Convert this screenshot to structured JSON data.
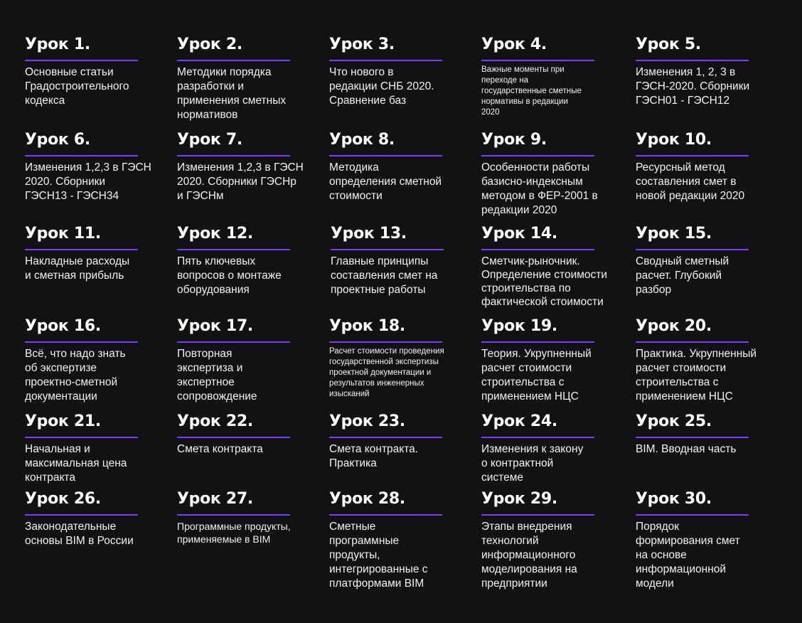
{
  "accent_color": "#7b3ff2",
  "background_color": "#121114",
  "lessons": [
    {
      "title": "Урок 1.",
      "text": "Основные статьи\nГрадостроительного\nкодекса"
    },
    {
      "title": "Урок 2.",
      "text": "Методики порядка\nразработки и\nприменения сметных\nнормативов"
    },
    {
      "title": "Урок 3.",
      "text": "Что нового в\nредакции СНБ 2020.\nСравнение баз"
    },
    {
      "title": "Урок 4.",
      "text": "Важные моменты при\nпереходе на\nгосударственные сметные\nнормативы в редакции\n2020"
    },
    {
      "title": "Урок 5.",
      "text": "Изменения 1, 2, 3 в\nГЭСН-2020. Сборники\nГЭСН01 - ГЭСН12"
    },
    {
      "title": "Урок 6.",
      "text": "Изменения 1,2,3 в ГЭСН\n2020. Сборники\nГЭСН13 - ГЭСН34"
    },
    {
      "title": "Урок 7.",
      "text": "Изменения 1,2,3 в ГЭСН\n2020. Сборники ГЭСНр\nи ГЭСНм"
    },
    {
      "title": "Урок 8.",
      "text": "Методика\nопределения сметной\nстоимости"
    },
    {
      "title": "Урок 9.",
      "text": "Особенности работы\nбазисно-индексным\nметодом в ФЕР-2001 в\nредакции 2020"
    },
    {
      "title": "Урок 10.",
      "text": "Ресурсный метод\nсоставления смет в\nновой редакции 2020"
    },
    {
      "title": "Урок 11.",
      "text": "Накладные расходы\nи сметная прибыль"
    },
    {
      "title": "Урок 12.",
      "text": "Пять ключевых\nвопросов о монтаже\nоборудования"
    },
    {
      "title": "Урок 13.",
      "text": "Главные принципы\nсоставления смет на\nпроектные работы"
    },
    {
      "title": "Урок 14.",
      "text": "Сметчик-рыночник.\nОпределение стоимости\nстроительства по\nфактической стоимости"
    },
    {
      "title": "Урок 15.",
      "text": "Сводный сметный\nрасчет. Глубокий\nразбор"
    },
    {
      "title": "Урок 16.",
      "text": "Всё, что надо знать\nоб экспертизе\nпроектно-сметной\nдокументации"
    },
    {
      "title": "Урок 17.",
      "text": "Повторная\nэкспертиза и\nэкспертное\nсопровождение"
    },
    {
      "title": "Урок 18.",
      "text": "Расчет стоимости проведения\nгосударственной экспертизы\nпроектной документации и\nрезультатов инженерных\nизысканий"
    },
    {
      "title": "Урок 19.",
      "text": "Теория. Укрупненный\nрасчет стоимости\nстроительства с\nприменением НЦС"
    },
    {
      "title": "Урок 20.",
      "text": "Практика. Укрупненный\nрасчет стоимости\nстроительства с\nприменением НЦС"
    },
    {
      "title": "Урок 21.",
      "text": "Начальная и\nмаксимальная цена\nконтракта"
    },
    {
      "title": "Урок 22.",
      "text": "Смета контракта"
    },
    {
      "title": "Урок 23.",
      "text": "Смета контракта.\nПрактика"
    },
    {
      "title": "Урок 24.",
      "text": "Изменения к закону\nо контрактной\nсистеме"
    },
    {
      "title": "Урок 25.",
      "text": "BIM. Вводная часть"
    },
    {
      "title": "Урок 26.",
      "text": "Законодательные\nосновы BIM в России"
    },
    {
      "title": "Урок 27.",
      "text": "Программные продукты,\nприменяемые в BIM"
    },
    {
      "title": "Урок 28.",
      "text": "Сметные\nпрограммные\nпродукты,\nинтегрированные с\nплатформами BIM"
    },
    {
      "title": "Урок 29.",
      "text": "Этапы внедрения\nтехнологий\nинформационного\nмоделирования на\nпредприятии"
    },
    {
      "title": "Урок 30.",
      "text": "Порядок\nформирования смет\nна основе\nинформационной\nмодели"
    }
  ]
}
